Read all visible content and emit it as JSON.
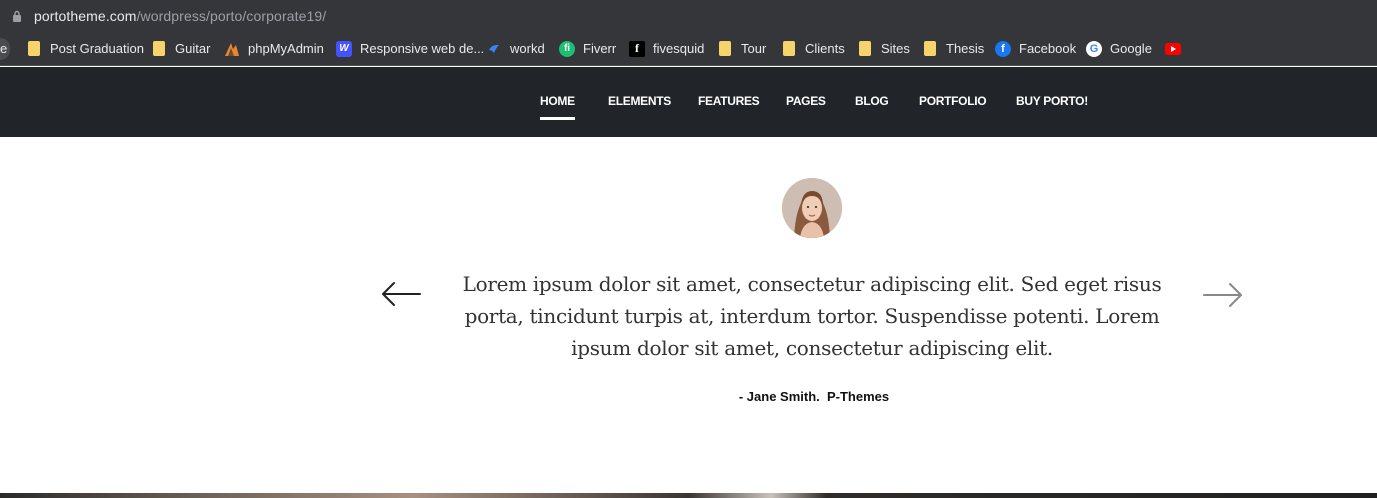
{
  "browser": {
    "url_host": "portotheme.com",
    "url_path": "/wordpress/porto/corporate19/",
    "bookmarks_edge_label": "e",
    "bookmarks": [
      {
        "label": "Post Graduation",
        "icon": "folder-icon"
      },
      {
        "label": "Guitar",
        "icon": "folder-icon"
      },
      {
        "label": "phpMyAdmin",
        "icon": "phpmyadmin-icon"
      },
      {
        "label": "Responsive web de...",
        "icon": "webflow-icon"
      },
      {
        "label": "workd",
        "icon": "workd-icon"
      },
      {
        "label": "Fiverr",
        "icon": "fiverr-icon"
      },
      {
        "label": "fivesquid",
        "icon": "fivesquid-icon"
      },
      {
        "label": "Tour",
        "icon": "folder-icon"
      },
      {
        "label": "Clients",
        "icon": "folder-icon"
      },
      {
        "label": "Sites",
        "icon": "folder-icon"
      },
      {
        "label": "Thesis",
        "icon": "folder-icon"
      },
      {
        "label": "Facebook",
        "icon": "facebook-icon"
      },
      {
        "label": "Google",
        "icon": "google-icon"
      },
      {
        "label": "",
        "icon": "youtube-icon"
      }
    ]
  },
  "nav": {
    "items": [
      "HOME",
      "ELEMENTS",
      "FEATURES",
      "PAGES",
      "BLOG",
      "PORTFOLIO",
      "BUY PORTO!"
    ],
    "active": "HOME"
  },
  "testimonial": {
    "quote_lines": [
      "Lorem ipsum dolor sit amet, consectetur adipiscing elit. Sed eget risus",
      "porta, tincidunt turpis at, interdum tortor. Suspendisse potenti. Lorem",
      "ipsum dolor sit amet, consectetur adipiscing elit."
    ],
    "author": "- Jane Smith.  P-Themes"
  },
  "colors": {
    "browser_bg": "#35363a",
    "nav_bg": "#212529",
    "folder": "#f6d46b",
    "text_dark": "#333333"
  }
}
